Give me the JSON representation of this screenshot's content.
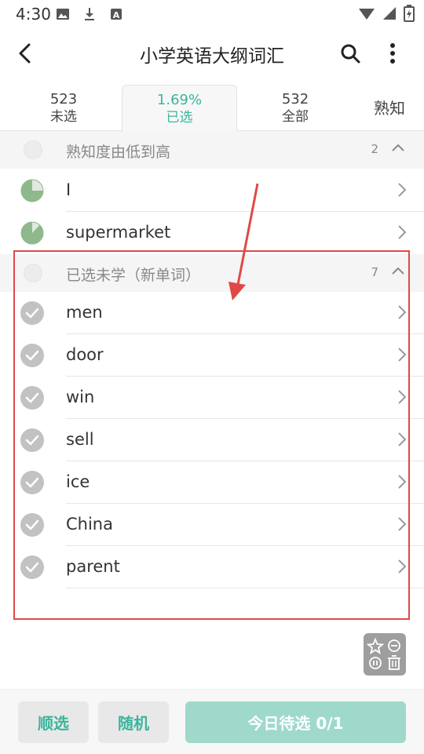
{
  "status_bar": {
    "time": "4:30",
    "left_icons": [
      "image-icon",
      "download-icon",
      "text-a-icon"
    ],
    "right_icons": [
      "wifi-icon",
      "signal-icon",
      "battery-icon"
    ]
  },
  "app_bar": {
    "title": "小学英语大纲词汇",
    "back_icon": "chevron-left-icon",
    "search_icon": "search-icon",
    "more_icon": "more-vert-icon"
  },
  "tabs": [
    {
      "num": "523",
      "label": "未选",
      "active": false
    },
    {
      "num": "1.69%",
      "label": "已选",
      "active": true
    },
    {
      "num": "532",
      "label": "全部",
      "active": false
    }
  ],
  "tab_extra": "熟知",
  "sections": {
    "familiar": {
      "title": "熟知度由低到高",
      "count": "2"
    },
    "new_words": {
      "title": "已选未学（新单词）",
      "count": "7"
    }
  },
  "familiar_words": [
    {
      "word": "I",
      "progress": 0.75
    },
    {
      "word": "supermarket",
      "progress": 0.88
    }
  ],
  "new_words": [
    {
      "word": "men"
    },
    {
      "word": "door"
    },
    {
      "word": "win"
    },
    {
      "word": "sell"
    },
    {
      "word": "ice"
    },
    {
      "word": "China"
    },
    {
      "word": "parent"
    }
  ],
  "bottom": {
    "sequential": "顺选",
    "random": "随机",
    "today": "今日待选 0/1"
  },
  "colors": {
    "accent": "#3bb59d",
    "progress_fill": "#8fb98c",
    "progress_bg": "#e2e9df",
    "check_circle": "#c2c2c2",
    "annotation": "#e04848"
  }
}
